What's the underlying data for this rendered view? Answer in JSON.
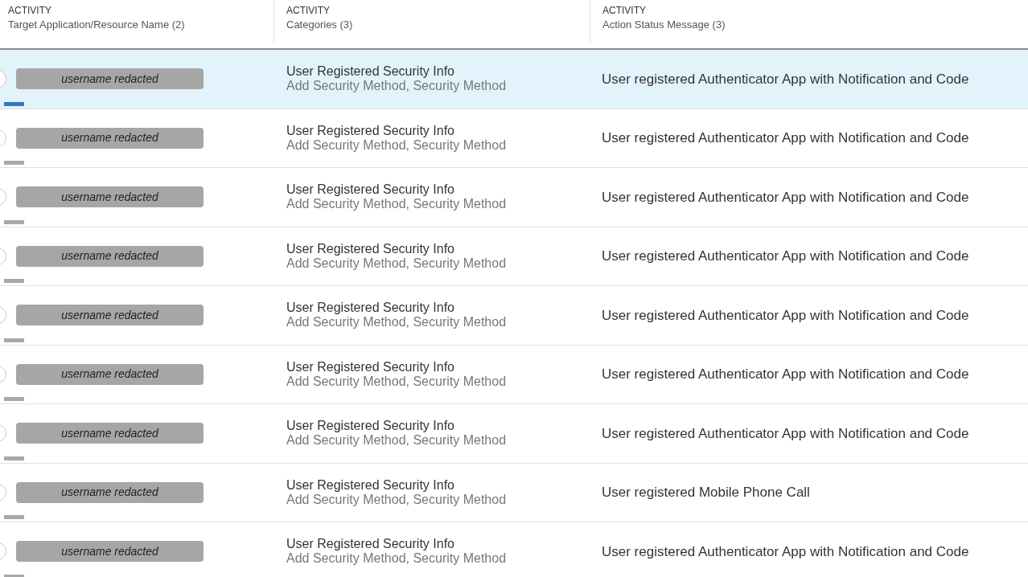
{
  "table": {
    "columns": [
      {
        "group": "ACTIVITY",
        "label": "Target Application/Resource Name (2)"
      },
      {
        "group": "ACTIVITY",
        "label": "Categories (3)"
      },
      {
        "group": "ACTIVITY",
        "label": "Action Status Message (3)"
      }
    ],
    "rows": [
      {
        "selected": true,
        "user": "username redacted",
        "activity": "User Registered Security Info",
        "categories": "Add Security Method, Security Method",
        "message": "User registered Authenticator App with Notification and Code"
      },
      {
        "selected": false,
        "user": "username redacted",
        "activity": "User Registered Security Info",
        "categories": "Add Security Method, Security Method",
        "message": "User registered Authenticator App with Notification and Code"
      },
      {
        "selected": false,
        "user": "username redacted",
        "activity": "User Registered Security Info",
        "categories": "Add Security Method, Security Method",
        "message": "User registered Authenticator App with Notification and Code"
      },
      {
        "selected": false,
        "user": "username redacted",
        "activity": "User Registered Security Info",
        "categories": "Add Security Method, Security Method",
        "message": "User registered Authenticator App with Notification and Code"
      },
      {
        "selected": false,
        "user": "username redacted",
        "activity": "User Registered Security Info",
        "categories": "Add Security Method, Security Method",
        "message": "User registered Authenticator App with Notification and Code"
      },
      {
        "selected": false,
        "user": "username redacted",
        "activity": "User Registered Security Info",
        "categories": "Add Security Method, Security Method",
        "message": "User registered Authenticator App with Notification and Code"
      },
      {
        "selected": false,
        "user": "username redacted",
        "activity": "User Registered Security Info",
        "categories": "Add Security Method, Security Method",
        "message": "User registered Authenticator App with Notification and Code"
      },
      {
        "selected": false,
        "user": "username redacted",
        "activity": "User Registered Security Info",
        "categories": "Add Security Method, Security Method",
        "message": "User registered Mobile Phone Call"
      },
      {
        "selected": false,
        "user": "username redacted",
        "activity": "User Registered Security Info",
        "categories": "Add Security Method, Security Method",
        "message": "User registered Authenticator App with Notification and Code"
      }
    ]
  }
}
